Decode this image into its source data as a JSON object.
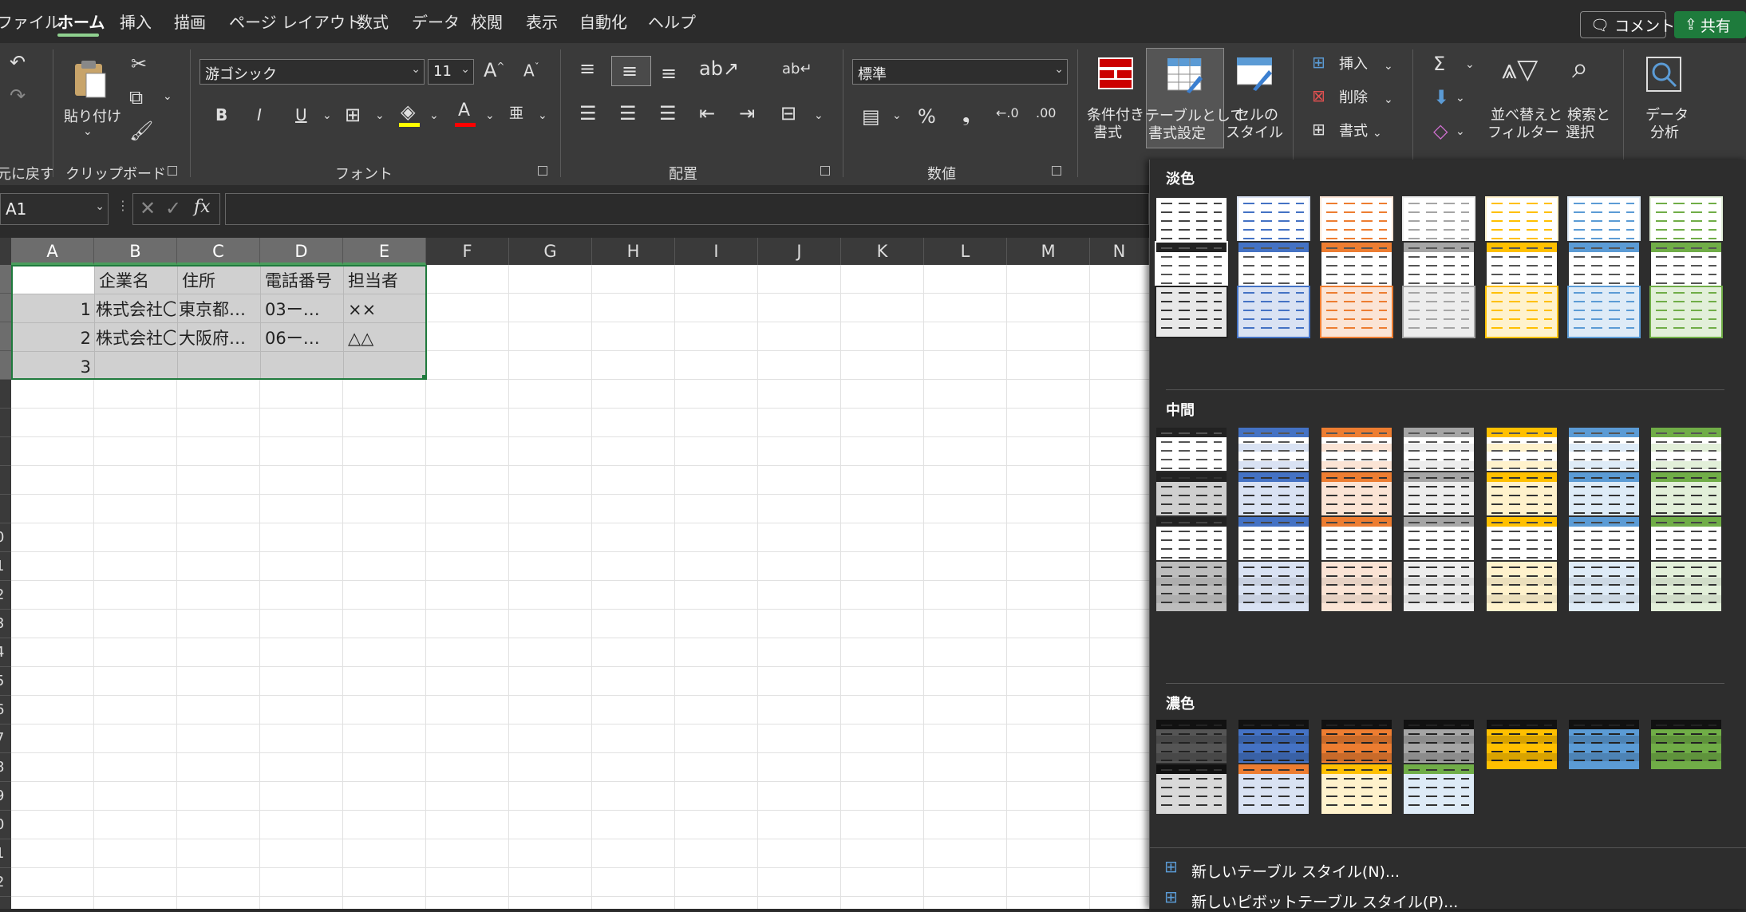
{
  "menubar": {
    "tabs": [
      "ファイル",
      "ホーム",
      "挿入",
      "描画",
      "ページ レイアウト",
      "数式",
      "データ",
      "校閲",
      "表示",
      "自動化",
      "ヘルプ"
    ],
    "active": "ホーム",
    "comment_label": "コメント",
    "share_label": "共有"
  },
  "ribbon": {
    "undo_label": "元に戻す",
    "clipboard": {
      "paste_label": "貼り付け",
      "group_label": "クリップボード"
    },
    "font": {
      "name": "游ゴシック",
      "size": "11",
      "group_label": "フォント"
    },
    "align": {
      "group_label": "配置"
    },
    "number": {
      "format": "標準",
      "group_label": "数値"
    },
    "styles": {
      "conditional_label_1": "条件付き",
      "conditional_label_2": "書式",
      "table_label_1": "テーブルとして",
      "table_label_2": "書式設定",
      "cell_label_1": "セルの",
      "cell_label_2": "スタイル"
    },
    "cells": {
      "insert_label": "挿入",
      "delete_label": "削除",
      "format_label": "書式"
    },
    "editing": {
      "sort_label_1": "並べ替えと",
      "sort_label_2": "フィルター",
      "find_label_1": "検索と",
      "find_label_2": "選択"
    },
    "analysis": {
      "label_1": "データ",
      "label_2": "分析"
    }
  },
  "formula_bar": {
    "name_box": "A1",
    "fx": "fx",
    "formula": ""
  },
  "sheet": {
    "columns": [
      "A",
      "B",
      "C",
      "D",
      "E",
      "F",
      "G",
      "H",
      "I",
      "J",
      "K",
      "L",
      "M",
      "N"
    ],
    "rows": [
      [
        "",
        "企業名",
        "住所",
        "電話番号",
        "担当者"
      ],
      [
        "1",
        "株式会社〇",
        "東京都…",
        "03ー…",
        "××"
      ],
      [
        "2",
        "株式会社〇",
        "大阪府…",
        "06ー…",
        "△△"
      ],
      [
        "3",
        "",
        "",
        "",
        ""
      ]
    ],
    "row_numbers_visible": [
      "",
      "",
      "",
      "",
      "",
      "",
      "",
      "",
      "",
      "0",
      "1",
      "2",
      "3",
      "4",
      "5",
      "6",
      "7",
      "8",
      "9",
      "0",
      "1",
      "2"
    ]
  },
  "gallery": {
    "section_light": "淡色",
    "section_medium": "中間",
    "section_dark": "濃色",
    "new_table_style": "新しいテーブル スタイル(N)...",
    "new_pivot_style": "新しいピボットテーブル スタイル(P)...",
    "palette": [
      "#222222",
      "#4472c4",
      "#ed7d31",
      "#a5a5a5",
      "#ffc000",
      "#5b9bd5",
      "#70ad47"
    ],
    "palette_light": [
      "#ffffff",
      "#d9e2f3",
      "#fbe4d5",
      "#ededed",
      "#fff2cc",
      "#deebf7",
      "#e2efd9"
    ]
  }
}
